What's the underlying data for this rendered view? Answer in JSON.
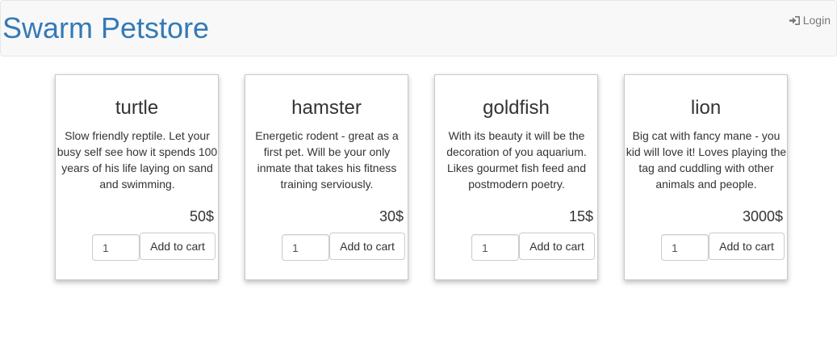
{
  "header": {
    "brand": "Swarm Petstore",
    "login_label": "Login",
    "login_icon": "sign-in-icon",
    "brand_color": "#337ab7"
  },
  "products": [
    {
      "name": "turtle",
      "description": "Slow friendly reptile. Let your busy self see how it spends 100 years of his life laying on sand and swimming.",
      "price": "50$",
      "quantity": "1",
      "add_label": "Add to cart"
    },
    {
      "name": "hamster",
      "description": "Energetic rodent - great as a first pet. Will be your only inmate that takes his fitness training serviously.",
      "price": "30$",
      "quantity": "1",
      "add_label": "Add to cart"
    },
    {
      "name": "goldfish",
      "description": "With its beauty it will be the decoration of you aquarium. Likes gourmet fish feed and postmodern poetry.",
      "price": "15$",
      "quantity": "1",
      "add_label": "Add to cart"
    },
    {
      "name": "lion",
      "description": "Big cat with fancy mane - you kid will love it! Loves playing the tag and cuddling with other animals and people.",
      "price": "3000$",
      "quantity": "1",
      "add_label": "Add to cart"
    }
  ]
}
